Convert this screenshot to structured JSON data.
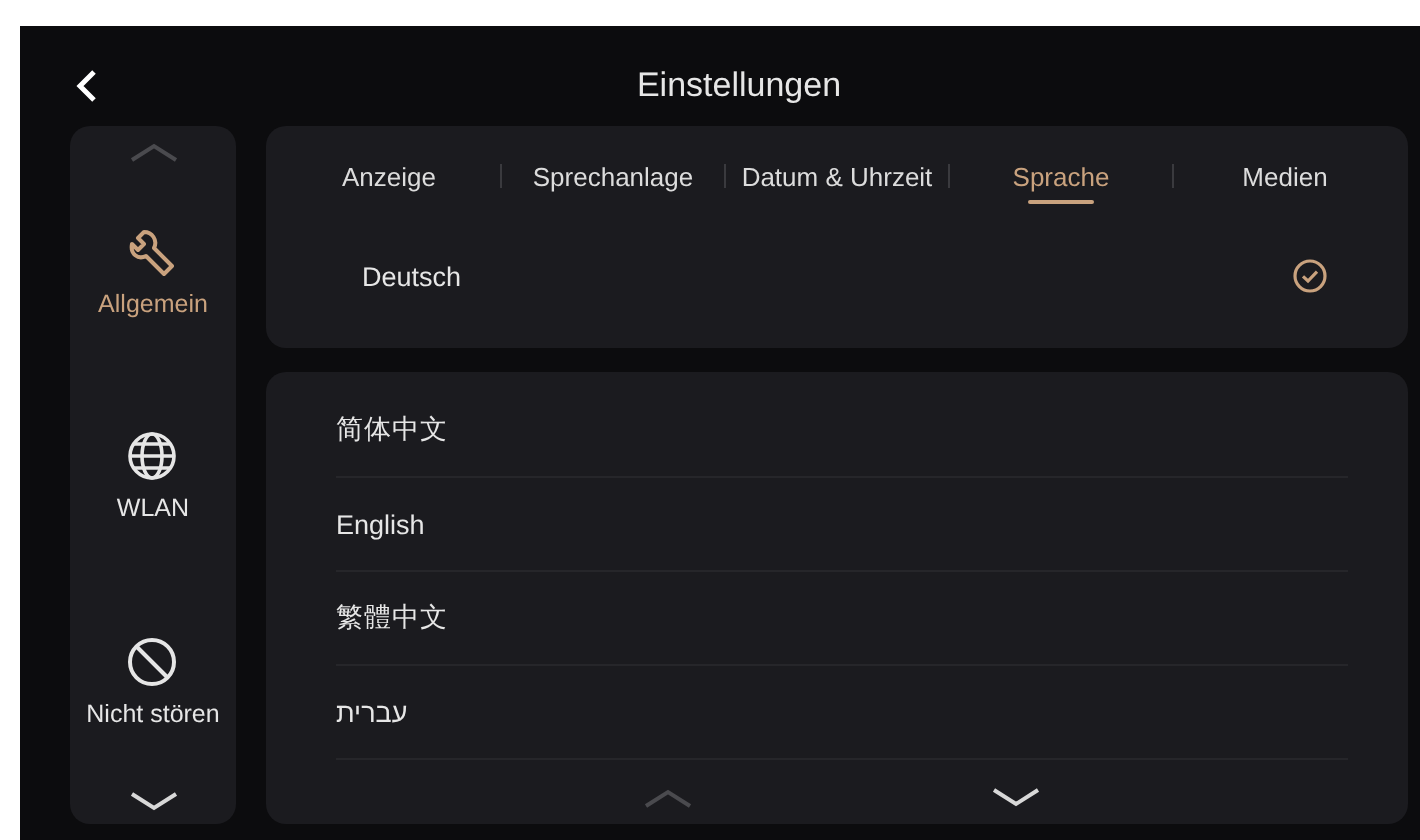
{
  "header": {
    "title": "Einstellungen"
  },
  "sidebar": {
    "items": [
      {
        "label": "Allgemein",
        "kind": "wrench",
        "selected": true
      },
      {
        "label": "WLAN",
        "kind": "globe",
        "selected": false
      },
      {
        "label": "Nicht stören",
        "kind": "block",
        "selected": false
      }
    ]
  },
  "tabs": [
    {
      "label": "Anzeige",
      "selected": false
    },
    {
      "label": "Sprechanlage",
      "selected": false
    },
    {
      "label": "Datum & Uhrzeit",
      "selected": false
    },
    {
      "label": "Sprache",
      "selected": true
    },
    {
      "label": "Medien",
      "selected": false
    }
  ],
  "current_language": {
    "label": "Deutsch",
    "checked": true
  },
  "languages": [
    {
      "label": "简体中文"
    },
    {
      "label": "English"
    },
    {
      "label": "繁體中文"
    },
    {
      "label": "עברית"
    }
  ]
}
